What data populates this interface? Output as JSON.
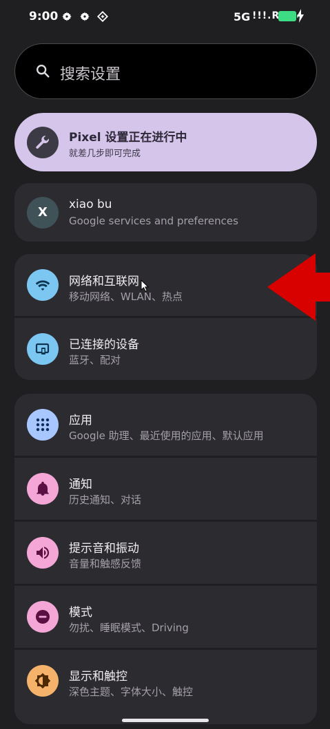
{
  "status": {
    "time": "9:00",
    "network": "5G",
    "signal": "!!!.R",
    "icons": [
      "gear-icon",
      "gear-icon",
      "cast-icon",
      "battery-icon",
      "charging-icon"
    ],
    "battery_color": "#3ddc84"
  },
  "search": {
    "placeholder": "搜索设置",
    "icon": "search-icon"
  },
  "banner": {
    "title": "Pixel 设置正在进行中",
    "subtitle": "就差几步即可完成",
    "icon": "wrench-icon",
    "color": "#d5c5ea"
  },
  "account": {
    "avatar_letter": "X",
    "name": "xiao bu",
    "subtitle": "Google services and preferences"
  },
  "group1": [
    {
      "title": "网络和互联网",
      "subtitle": "移动网络、WLAN、热点",
      "icon": "wifi-icon",
      "color": "#7cc6f2"
    },
    {
      "title": "已连接的设备",
      "subtitle": "蓝牙、配对",
      "icon": "devices-icon",
      "color": "#7cc6f2"
    }
  ],
  "group2": [
    {
      "title": "应用",
      "subtitle": "Google 助理、最近使用的应用、默认应用",
      "icon": "apps-grid-icon",
      "color": "#a9c7ff"
    },
    {
      "title": "通知",
      "subtitle": "历史通知、对话",
      "icon": "bell-icon",
      "color": "#f4a6d6"
    },
    {
      "title": "提示音和振动",
      "subtitle": "音量和触感反馈",
      "icon": "speaker-icon",
      "color": "#f4a6d6"
    },
    {
      "title": "模式",
      "subtitle": "勿扰、睡眠模式、Driving",
      "icon": "dnd-icon",
      "color": "#f4a6d6"
    },
    {
      "title": "显示和触控",
      "subtitle": "深色主题、字体大小、触控",
      "icon": "brightness-icon",
      "color": "#f5b26b"
    }
  ],
  "accent_colors": {
    "arrow": "#d90000",
    "background": "#1f1f22",
    "card": "#2c2c30"
  }
}
